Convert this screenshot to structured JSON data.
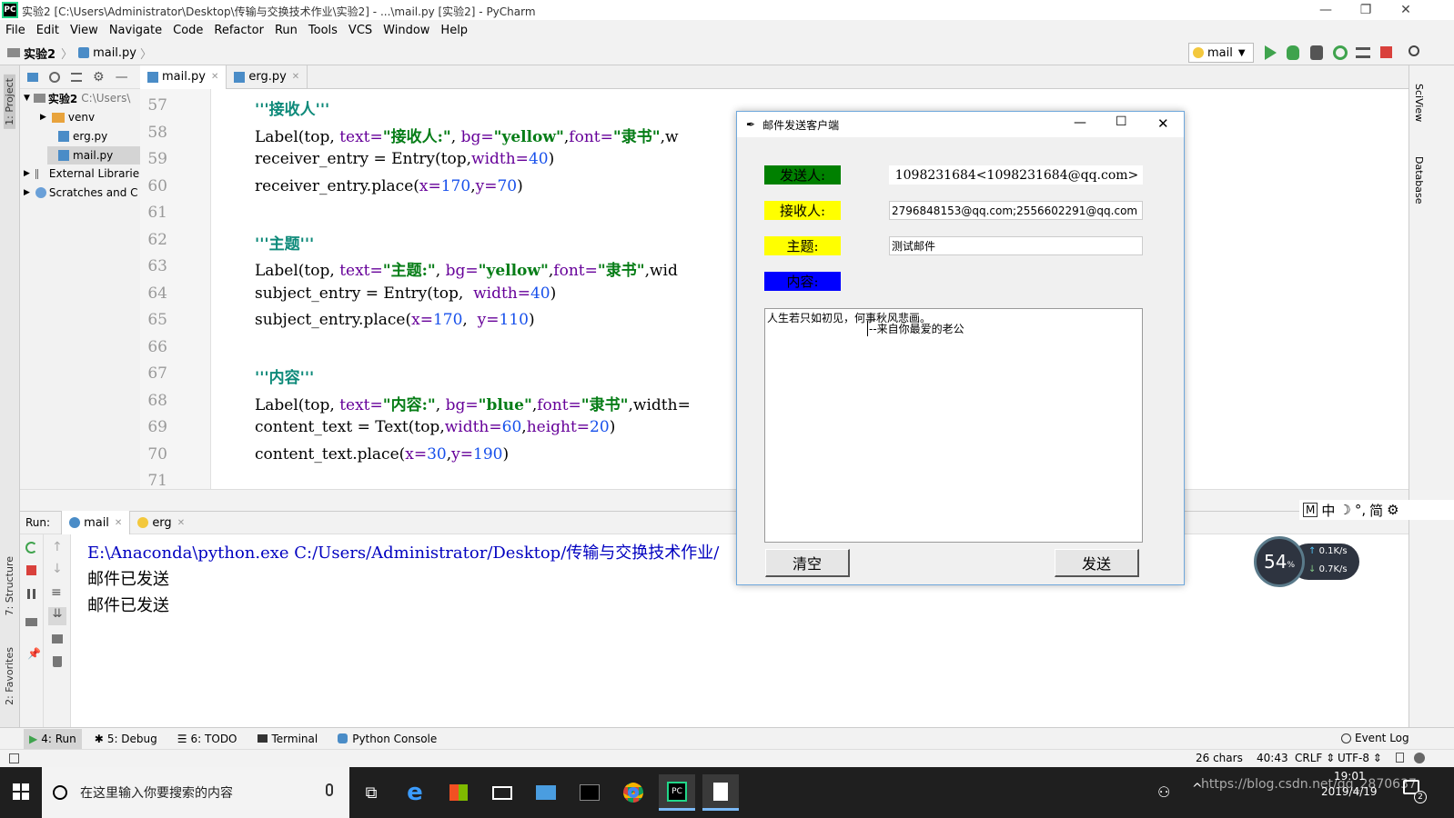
{
  "window": {
    "app_icon_label": "PC",
    "title": "实验2 [C:\\Users\\Administrator\\Desktop\\传输与交换技术作业\\实验2] - ...\\mail.py [实验2] - PyCharm"
  },
  "menu": [
    "File",
    "Edit",
    "View",
    "Navigate",
    "Code",
    "Refactor",
    "Run",
    "Tools",
    "VCS",
    "Window",
    "Help"
  ],
  "nav": {
    "breadcrumb_project": "实验2",
    "breadcrumb_file": "mail.py",
    "run_config": "mail"
  },
  "left_strip": {
    "project": "1: Project",
    "structure": "7: Structure",
    "favorites": "2: Favorites"
  },
  "right_strip": {
    "sciview": "SciView",
    "database": "Database"
  },
  "project_tree": [
    {
      "label": "实验2",
      "extra": "C:\\Users\\"
    },
    {
      "label": "venv"
    },
    {
      "label": "erg.py"
    },
    {
      "label": "mail.py"
    },
    {
      "label": "External Librarie"
    },
    {
      "label": "Scratches and C"
    }
  ],
  "editor_tabs": [
    "mail.py",
    "erg.py"
  ],
  "code": {
    "line_numbers": [
      "57",
      "58",
      "59",
      "60",
      "61",
      "62",
      "63",
      "64",
      "65",
      "66",
      "67",
      "68",
      "69",
      "70",
      "71"
    ],
    "l57": "'''接收人'''",
    "l58": {
      "a": "Label(top, ",
      "b": "text=",
      "c": "\"接收人:\"",
      "d": ", ",
      "e": "bg=",
      "f": "\"yellow\"",
      "g": ",",
      "h": "font=",
      "i": "\"隶书\"",
      "j": ",w"
    },
    "l59": {
      "a": "receiver_entry = Entry(top,",
      "b": "width=",
      "c": "40",
      "d": ")"
    },
    "l60": {
      "a": "receiver_entry.place(",
      "b": "x=",
      "c": "170",
      "d": ",",
      "e": "y=",
      "f": "70",
      "g": ")"
    },
    "l62": "'''主题'''",
    "l63": {
      "a": "Label(top, ",
      "b": "text=",
      "c": "\"主题:\"",
      "d": ", ",
      "e": "bg=",
      "f": "\"yellow\"",
      "g": ",",
      "h": "font=",
      "i": "\"隶书\"",
      "j": ",wid"
    },
    "l64": {
      "a": "subject_entry = Entry(top,  ",
      "b": "width=",
      "c": "40",
      "d": ")"
    },
    "l65": {
      "a": "subject_entry.place(",
      "b": "x=",
      "c": "170",
      "d": ",  ",
      "e": "y=",
      "f": "110",
      "g": ")"
    },
    "l67": "'''内容'''",
    "l68": {
      "a": "Label(top, ",
      "b": "text=",
      "c": "\"内容:\"",
      "d": ", ",
      "e": "bg=",
      "f": "\"blue\"",
      "g": ",",
      "h": "font=",
      "i": "\"隶书\"",
      "j": ",width="
    },
    "l69": {
      "a": "content_text = Text(top,",
      "b": "width=",
      "c": "60",
      "d": ",",
      "e": "height=",
      "f": "20",
      "g": ")"
    },
    "l70": {
      "a": "content_text.place(",
      "b": "x=",
      "c": "30",
      "d": ",",
      "e": "y=",
      "f": "190",
      "g": ")"
    }
  },
  "run": {
    "label": "Run:",
    "tabs": [
      "mail",
      "erg"
    ],
    "console": [
      "E:\\Anaconda\\python.exe C:/Users/Administrator/Desktop/传输与交换技术作业/",
      "邮件已发送",
      "邮件已发送"
    ]
  },
  "dialog": {
    "title": "邮件发送客户端",
    "sender_label": "发送人:",
    "sender_value": "1098231684<1098231684@qq.com>",
    "receiver_label": "接收人:",
    "receiver_value": "2796848153@qq.com;2556602291@qq.com",
    "subject_label": "主题:",
    "subject_value": "测试邮件",
    "content_label": "内容:",
    "content_line1": "人生若只如初见，何事秋风悲画。",
    "content_line2": "--来自你最爱的老公",
    "clear_button": "清空",
    "send_button": "发送",
    "colors": {
      "sender_bg": "#008000",
      "yellow": "#ffff00",
      "content_bg": "#0000ff"
    }
  },
  "ime": {
    "m": "M",
    "zh": "中",
    "moon": "☽",
    "deg": "°,",
    "jian": "简",
    "gear": "⚙"
  },
  "speed_widget": {
    "percent": "54",
    "percent_sign": "%",
    "up": "0.1K/s",
    "down": "0.7K/s"
  },
  "bottom_tools": [
    "4: Run",
    "5: Debug",
    "6: TODO",
    "Terminal",
    "Python Console"
  ],
  "event_log": "Event Log",
  "status": {
    "chars": "26 chars",
    "position": "40:43",
    "line_sep": "CRLF",
    "encoding": "UTF-8"
  },
  "taskbar": {
    "search_placeholder": "在这里输入你要搜索的内容",
    "time": "19:01",
    "date": "2019/4/19",
    "tray_text": "https://blog.csdn.net/qq_2870637",
    "notification_count": "2"
  }
}
